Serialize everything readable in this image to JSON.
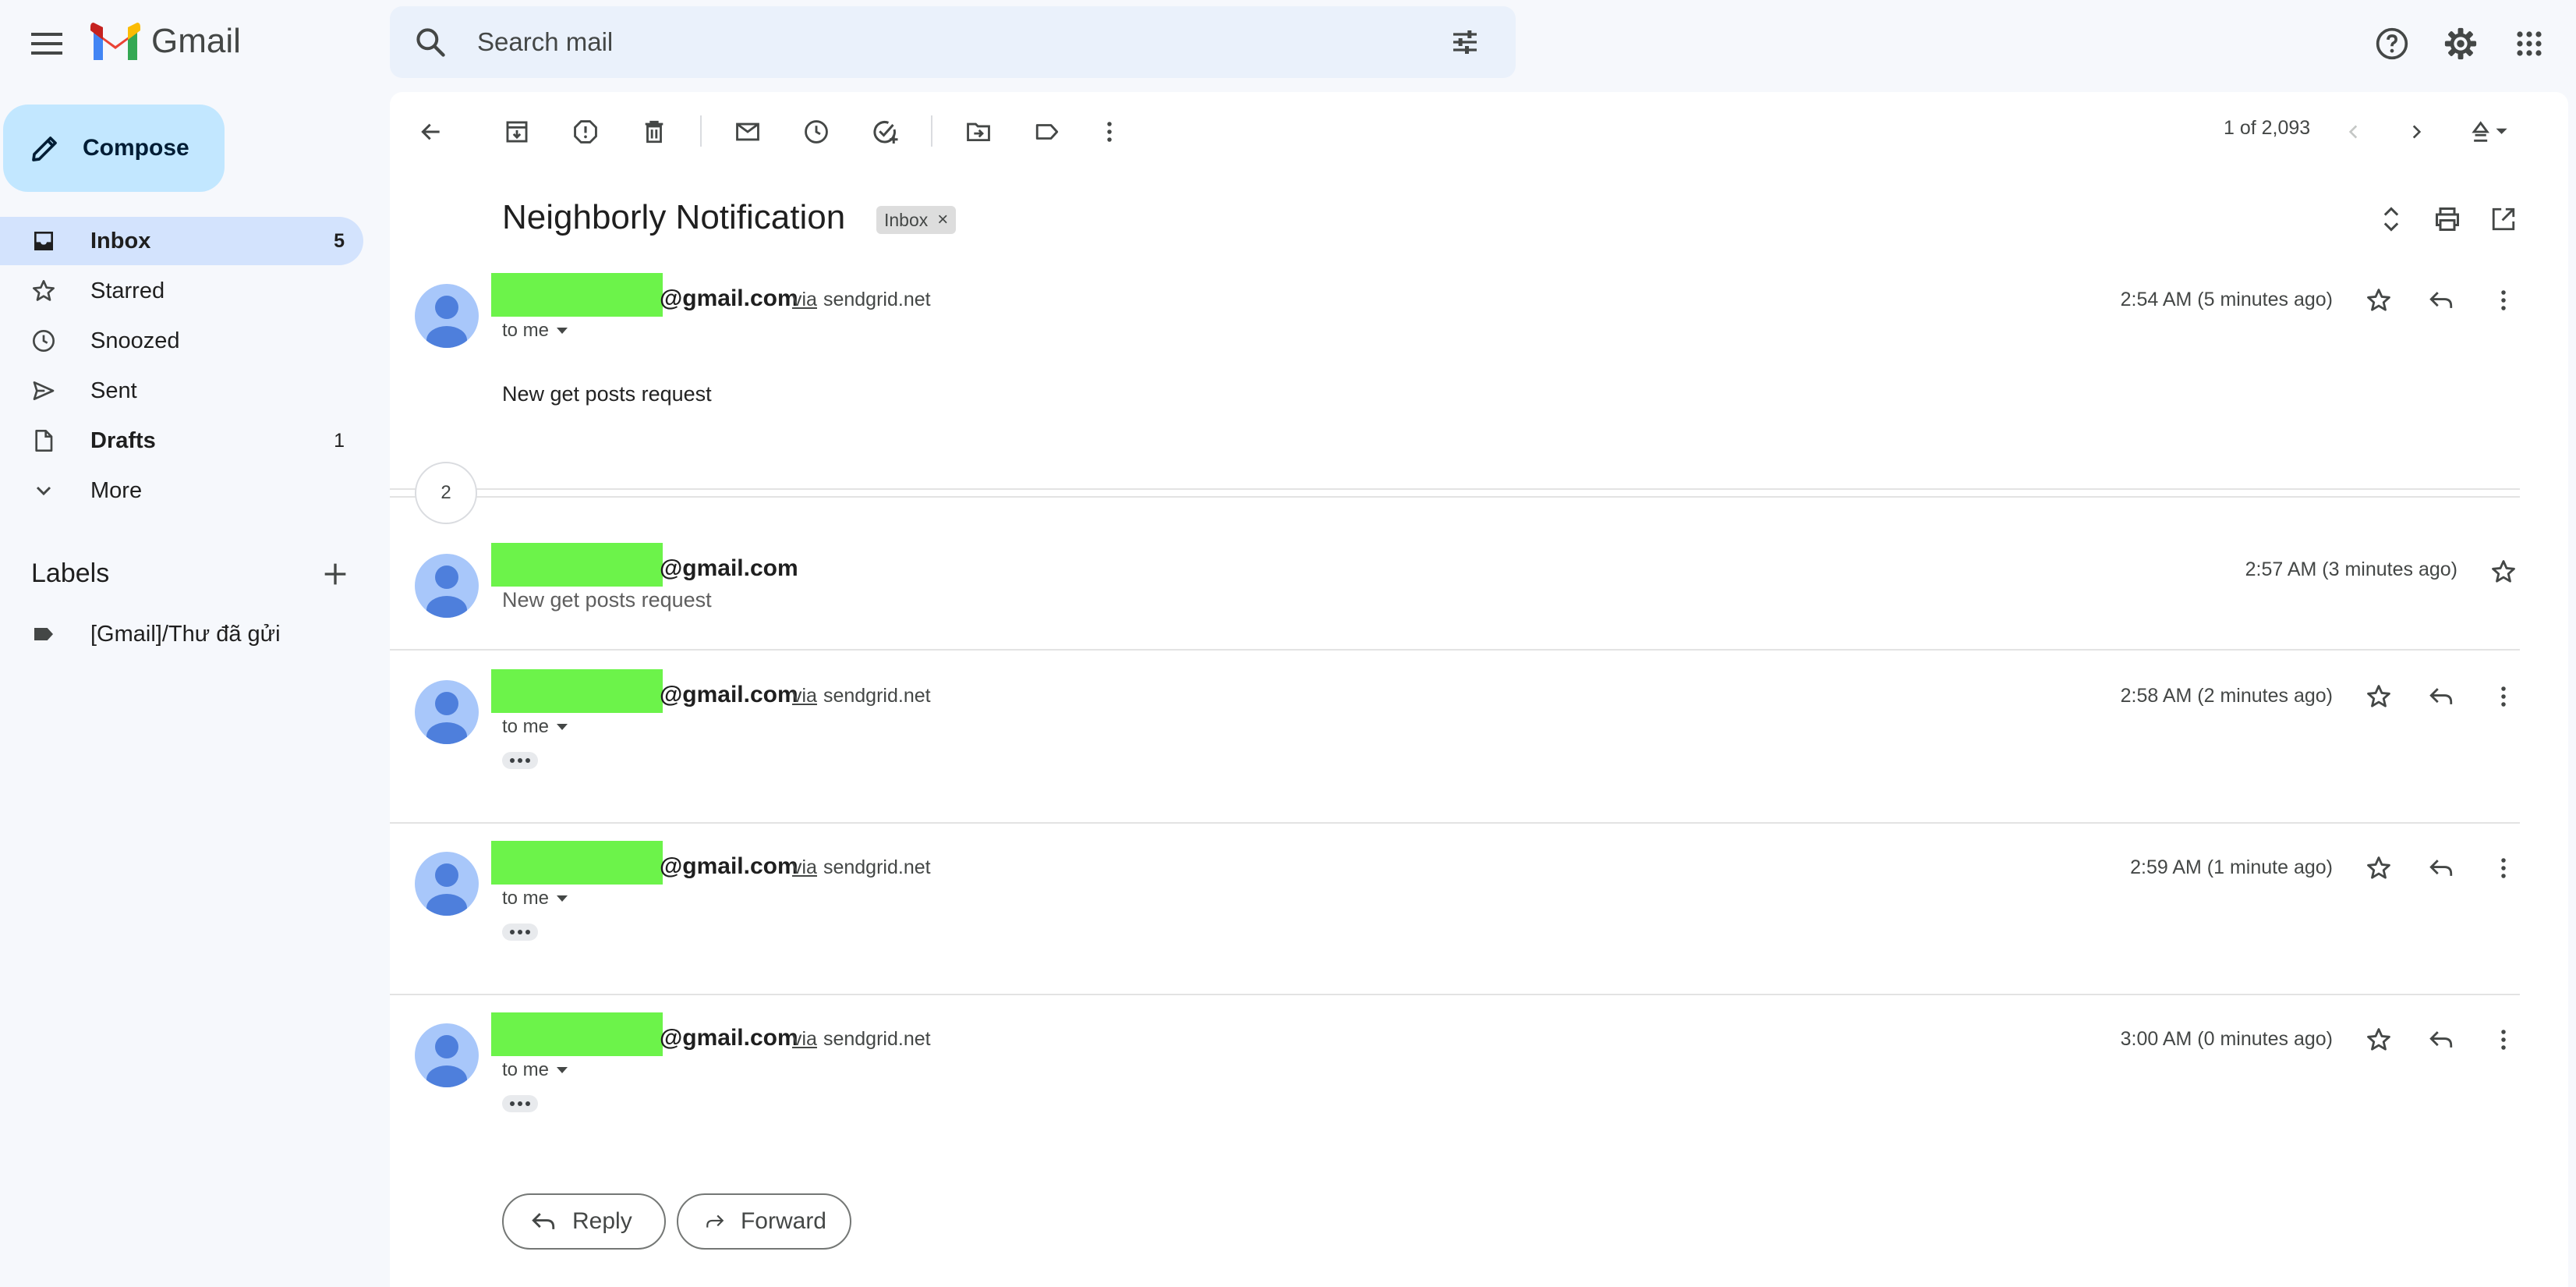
{
  "app": {
    "name": "Gmail",
    "search_placeholder": "Search mail"
  },
  "sidebar": {
    "compose_label": "Compose",
    "items": [
      {
        "label": "Inbox",
        "count": "5",
        "icon": "inbox-icon"
      },
      {
        "label": "Starred",
        "count": "",
        "icon": "star-icon"
      },
      {
        "label": "Snoozed",
        "count": "",
        "icon": "clock-icon"
      },
      {
        "label": "Sent",
        "count": "",
        "icon": "send-icon"
      },
      {
        "label": "Drafts",
        "count": "1",
        "icon": "draft-icon"
      },
      {
        "label": "More",
        "count": "",
        "icon": "chevron-down-icon"
      }
    ],
    "labels_heading": "Labels",
    "labels": [
      {
        "label": "[Gmail]/Thư đã gửi",
        "icon": "label-icon"
      }
    ]
  },
  "toolbar": {
    "pager": "1 of 2,093"
  },
  "thread": {
    "subject": "Neighborly Notification",
    "chip": "Inbox",
    "collapsed_count": "2",
    "messages": [
      {
        "sender": "@gmail.com",
        "via_label": "via",
        "via_domain": "sendgrid.net",
        "to": "to me",
        "time": "2:54 AM (5 minutes ago)",
        "body": "New get posts request"
      },
      {
        "sender": "@gmail.com",
        "time": "2:57 AM (3 minutes ago)",
        "snippet": "New get posts request"
      },
      {
        "sender": "@gmail.com",
        "via_label": "via",
        "via_domain": "sendgrid.net",
        "to": "to me",
        "time": "2:58 AM (2 minutes ago)"
      },
      {
        "sender": "@gmail.com",
        "via_label": "via",
        "via_domain": "sendgrid.net",
        "to": "to me",
        "time": "2:59 AM (1 minute ago)"
      },
      {
        "sender": "@gmail.com",
        "via_label": "via",
        "via_domain": "sendgrid.net",
        "to": "to me",
        "time": "3:00 AM (0 minutes ago)"
      }
    ],
    "reply_label": "Reply",
    "forward_label": "Forward"
  },
  "colors": {
    "accent": "#c2e7ff",
    "active_nav": "#d3e3fd",
    "redaction": "#6cf34a",
    "avatar": "#a8c7fa"
  }
}
